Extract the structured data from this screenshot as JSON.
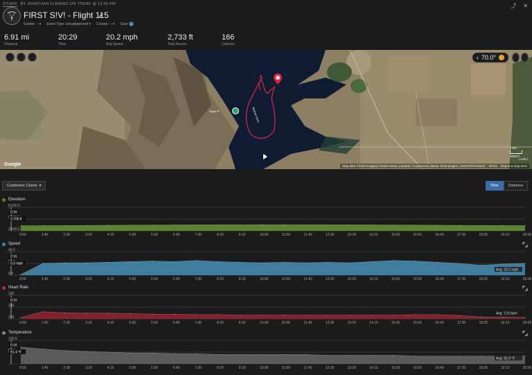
{
  "header": {
    "owner_select": "OTHER",
    "byline": "BY JONATHAN FLEMING ON TODAY @ 12:06 PM",
    "title": "FIRST S!V! - Flight 115",
    "meta": [
      {
        "label": "Events: --"
      },
      {
        "label": "Event Type: Uncategorized"
      },
      {
        "label": "Course: --"
      },
      {
        "label": "Gear",
        "badge": "1"
      }
    ]
  },
  "stats": [
    {
      "value": "6.91 mi",
      "label": "Distance"
    },
    {
      "value": "20:29",
      "label": "Time"
    },
    {
      "value": "20.2 mph",
      "label": "Avg Speed"
    },
    {
      "value": "2,733 ft",
      "label": "Total Ascent"
    },
    {
      "value": "166",
      "label": "Calories"
    }
  ],
  "map": {
    "temperature": "70.0°",
    "google": "Google",
    "attribution": "Map data ©2025 Imagery ©2025 Airbus, Landsat / Copernicus, Maxar Technologies, USDA/FPAC/GEO",
    "terms": "Terms",
    "report": "Report a map error",
    "scale_km": "1 km",
    "scale_ft": "3000 ft",
    "leaflet": "Leaflet",
    "route_label": "Mulcarr Dam",
    "marker_label": "Flight Pt"
  },
  "toolbar": {
    "customize_label": "Customize Charts",
    "toggle": [
      {
        "label": "Time",
        "active": true
      },
      {
        "label": "Distance",
        "active": false
      }
    ]
  },
  "colors": {
    "elevation": "#5b8a2e",
    "speed": "#3f84a8",
    "heart_rate": "#8c1f2d",
    "temperature": "#5e5e5e",
    "accent": "#3a6ea8"
  },
  "x_ticks": [
    "0:50",
    "1:40",
    "2:30",
    "3:20",
    "4:10",
    "5:00",
    "5:50",
    "6:40",
    "7:30",
    "8:20",
    "9:10",
    "10:00",
    "10:50",
    "11:40",
    "12:30",
    "13:20",
    "14:10",
    "15:00",
    "15:50",
    "16:40",
    "17:30",
    "18:20",
    "19:10",
    "20:00"
  ],
  "charts": [
    {
      "key": "elevation",
      "title": "Elevation",
      "y_labels": [
        "8,000.0",
        "5,000.0",
        "2,500.0"
      ],
      "cursor_time": "0:16",
      "cursor_value": "3,705 ft",
      "avg": ""
    },
    {
      "key": "speed",
      "title": "Speed",
      "y_labels": [
        "40.0",
        "20.0",
        "0.0"
      ],
      "cursor_time": "0:16",
      "cursor_value": "0.3 mph",
      "avg": "Avg: 20.2 mph"
    },
    {
      "key": "heart_rate",
      "title": "Heart Rate",
      "y_labels": [
        "160",
        "140",
        "120"
      ],
      "cursor_time": "0:16",
      "cursor_value": "",
      "avg": "Avg: 120 bpm"
    },
    {
      "key": "temperature",
      "title": "Temperature",
      "y_labels": [
        "100.0",
        "80.0"
      ],
      "cursor_time": "0:16",
      "cursor_value": "91.4 °F",
      "avg": "Avg: 82.4 °F"
    }
  ],
  "chart_data": [
    {
      "type": "area",
      "title": "Elevation",
      "xlabel": "",
      "ylabel": "",
      "x": [
        "0:50",
        "1:40",
        "2:30",
        "3:20",
        "4:10",
        "5:00",
        "5:50",
        "6:40",
        "7:30",
        "8:20",
        "9:10",
        "10:00",
        "10:50",
        "11:40",
        "12:30",
        "13:20",
        "14:10",
        "15:00",
        "15:50",
        "16:40",
        "17:30",
        "18:20",
        "19:10",
        "20:00"
      ],
      "series": [
        {
          "values": [
            3705,
            3710,
            3730,
            3760,
            3790,
            3820,
            3850,
            3880,
            3905,
            3920,
            3930,
            3935,
            3935,
            3930,
            3920,
            3905,
            3885,
            3860,
            3835,
            3805,
            3775,
            3745,
            3725,
            3715
          ]
        }
      ],
      "ylim": [
        2500,
        8000
      ]
    },
    {
      "type": "area",
      "title": "Speed",
      "xlabel": "",
      "ylabel": "",
      "x": [
        "0:50",
        "1:40",
        "2:30",
        "3:20",
        "4:10",
        "5:00",
        "5:50",
        "6:40",
        "7:30",
        "8:20",
        "9:10",
        "10:00",
        "10:50",
        "11:40",
        "12:30",
        "13:20",
        "14:10",
        "15:00",
        "15:50",
        "16:40",
        "17:30",
        "18:20",
        "19:10",
        "20:00"
      ],
      "series": [
        {
          "values": [
            1,
            20,
            21,
            21,
            22,
            23,
            24,
            23,
            25,
            23,
            22,
            21,
            22,
            21,
            22,
            21,
            23,
            25,
            24,
            22,
            20,
            17,
            19,
            20
          ]
        }
      ],
      "ylim": [
        0,
        40
      ]
    },
    {
      "type": "area",
      "title": "Heart Rate",
      "xlabel": "",
      "ylabel": "",
      "x": [
        "0:50",
        "1:40",
        "2:30",
        "3:20",
        "4:10",
        "5:00",
        "5:50",
        "6:40",
        "7:30",
        "8:20",
        "9:10",
        "10:00",
        "10:50",
        "11:40",
        "12:30",
        "13:20",
        "14:10",
        "15:00",
        "15:50",
        "16:40",
        "17:30",
        "18:20",
        "19:10",
        "20:00"
      ],
      "series": [
        {
          "values": [
            118,
            130,
            128,
            127,
            127,
            126,
            125,
            125,
            124,
            124,
            123,
            123,
            123,
            123,
            123,
            123,
            123,
            123,
            124,
            124,
            122,
            119,
            119,
            118
          ]
        }
      ],
      "ylim": [
        115,
        165
      ]
    },
    {
      "type": "area",
      "title": "Temperature",
      "xlabel": "",
      "ylabel": "",
      "x": [
        "0:50",
        "1:40",
        "2:30",
        "3:20",
        "4:10",
        "5:00",
        "5:50",
        "6:40",
        "7:30",
        "8:20",
        "9:10",
        "10:00",
        "10:50",
        "11:40",
        "12:30",
        "13:20",
        "14:10",
        "15:00",
        "15:50",
        "16:40",
        "17:30",
        "18:20",
        "19:10",
        "20:00"
      ],
      "series": [
        {
          "values": [
            91.4,
            89,
            87,
            86,
            85,
            84,
            84,
            83,
            83,
            82,
            82,
            82,
            82,
            82,
            81,
            81,
            81,
            81,
            80,
            80,
            80,
            80,
            80,
            80
          ]
        }
      ],
      "ylim": [
        70,
        100
      ]
    }
  ]
}
